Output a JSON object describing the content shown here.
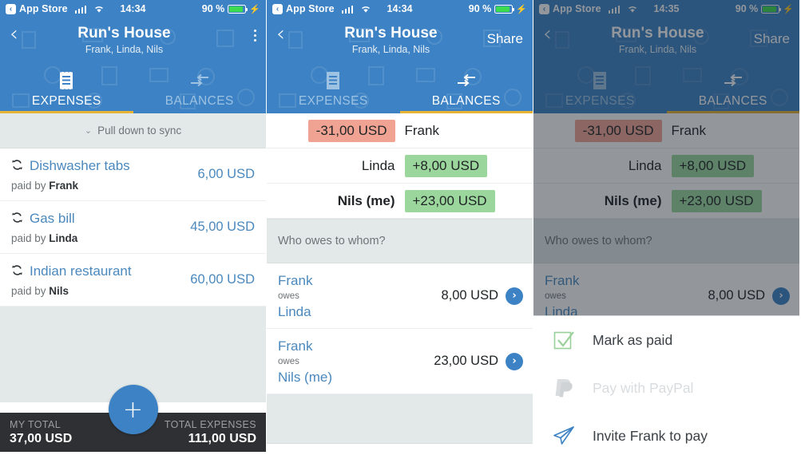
{
  "app": {
    "status_bar": {
      "back_app": "App Store",
      "back_glyph": "‹",
      "time_p1": "14:34",
      "time_p2": "14:34",
      "time_p3": "14:35",
      "battery_pct": "90 %",
      "bolt": "⚡",
      "icons": [
        "cellular-signal-icon",
        "wifi-icon",
        "battery-icon"
      ]
    },
    "nav": {
      "back_glyph": "‹",
      "title": "Run's House",
      "subtitle": "Frank, Linda, Nils",
      "menu_glyph": "kebab-menu-icon",
      "share_label": "Share"
    },
    "tabs": [
      {
        "label": "EXPENSES",
        "icon": "receipt-icon"
      },
      {
        "label": "BALANCES",
        "icon": "transfer-arrows-icon"
      }
    ],
    "accent_yellow": "#e8b335",
    "accent_blue": "#3d82c4",
    "link_blue": "#4a88bd"
  },
  "panel1": {
    "active_tab": "EXPENSES",
    "sync": {
      "chevron": "⌄",
      "label": "Pull down to sync"
    },
    "expenses": [
      {
        "icon": "sync-icon",
        "title": "Dishwasher tabs",
        "paid_prefix": "paid by ",
        "payer": "Frank",
        "amount": "6,00 USD"
      },
      {
        "icon": "sync-icon",
        "title": "Gas bill",
        "paid_prefix": "paid by ",
        "payer": "Linda",
        "amount": "45,00 USD"
      },
      {
        "icon": "sync-icon",
        "title": "Indian restaurant",
        "paid_prefix": "paid by ",
        "payer": "Nils",
        "amount": "60,00 USD"
      }
    ],
    "totals": {
      "my_total_label": "MY TOTAL",
      "my_total_value": "37,00 USD",
      "total_expenses_label": "TOTAL EXPENSES",
      "total_expenses_value": "111,00 USD"
    },
    "fab": {
      "glyph": "+",
      "name": "add-expense-button"
    }
  },
  "panel2": {
    "active_tab": "BALANCES",
    "balances": [
      {
        "name": "Frank",
        "amount": "-31,00 USD",
        "sign": "negative",
        "side": "left",
        "me": false
      },
      {
        "name": "Linda",
        "amount": "+8,00 USD",
        "sign": "positive",
        "side": "right",
        "me": false
      },
      {
        "name": "Nils (me)",
        "amount": "+23,00 USD",
        "sign": "positive",
        "side": "right",
        "me": true
      }
    ],
    "section_title": "Who owes to whom?",
    "debts": [
      {
        "from": "Frank",
        "owes_word": "owes",
        "to": "Linda",
        "amount": "8,00 USD",
        "chevron": "›"
      },
      {
        "from": "Frank",
        "owes_word": "owes",
        "to": "Nils (me)",
        "amount": "23,00 USD",
        "chevron": "›"
      }
    ]
  },
  "panel3": {
    "active_tab": "BALANCES",
    "sheet": {
      "items": [
        {
          "label": "Mark as paid",
          "icon": "check-box-icon",
          "disabled": false
        },
        {
          "label": "Pay with PayPal",
          "icon": "paypal-icon",
          "disabled": true
        },
        {
          "label": "Invite Frank to pay",
          "icon": "paper-plane-icon",
          "disabled": false
        }
      ]
    }
  }
}
